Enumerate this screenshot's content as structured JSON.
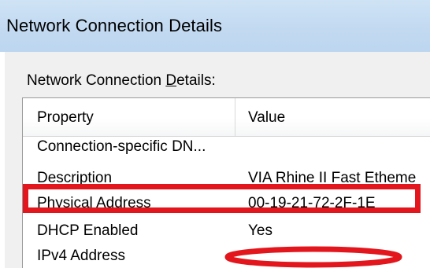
{
  "window": {
    "title": "Network Connection Details"
  },
  "group": {
    "label_prefix": "Network Connection ",
    "label_accel": "D",
    "label_suffix": "etails:"
  },
  "table": {
    "columns": [
      "Property",
      "Value"
    ],
    "rows": [
      {
        "property": "Connection-specific DN...",
        "value": ""
      },
      {
        "property": "Description",
        "value": "VIA Rhine II Fast Etheme"
      },
      {
        "property": "Physical Address",
        "value": "00-19-21-72-2F-1E"
      },
      {
        "property": "DHCP Enabled",
        "value": "Yes"
      },
      {
        "property": "IPv4 Address",
        "value": ""
      }
    ]
  },
  "annotations": {
    "highlight_color": "#e2161c",
    "highlighted_row": "Physical Address",
    "redacted_row": "IPv4 Address"
  }
}
